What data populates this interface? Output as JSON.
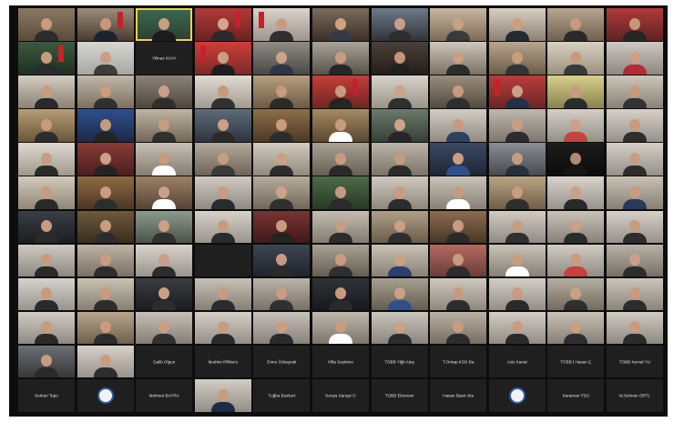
{
  "window": {
    "title": ""
  },
  "participants": [
    {
      "type": "cam",
      "a": "#8a7a63",
      "b": "#5b4a3a",
      "skin": "#c99b7b",
      "shirt": "#2c2c2c",
      "flag": false
    },
    {
      "type": "cam",
      "a": "#9b8d7d",
      "b": "#4a3a30",
      "skin": "#c8977a",
      "shirt": "#1e2230",
      "flag": true
    },
    {
      "type": "cam",
      "a": "#3e6a4e",
      "b": "#2c3d33",
      "skin": "#c7a084",
      "shirt": "#1c1c1c",
      "flag": false,
      "speaker": true
    },
    {
      "type": "cam",
      "a": "#b23b38",
      "b": "#6a2221",
      "skin": "#d4a58a",
      "shirt": "#2a2a2a",
      "flag": true
    },
    {
      "type": "cam",
      "a": "#d9d4cb",
      "b": "#9d948b",
      "skin": "#c69b80",
      "shirt": "#303030",
      "flag": true
    },
    {
      "type": "cam",
      "a": "#7b6b5b",
      "b": "#3b3028",
      "skin": "#cfa286",
      "shirt": "#323a48",
      "flag": false
    },
    {
      "type": "cam",
      "a": "#6d7b89",
      "b": "#30343a",
      "skin": "#c89e85",
      "shirt": "#2e2e2e",
      "flag": false
    },
    {
      "type": "cam",
      "a": "#c8b79f",
      "b": "#7c6a55",
      "skin": "#caa084",
      "shirt": "#3a3a3a",
      "flag": false
    },
    {
      "type": "cam",
      "a": "#d8cfc2",
      "b": "#8c8174",
      "skin": "#cc9f80",
      "shirt": "#242933",
      "flag": false
    },
    {
      "type": "cam",
      "a": "#b8a58f",
      "b": "#6f604f",
      "skin": "#c9997c",
      "shirt": "#2a2a2a",
      "flag": false
    },
    {
      "type": "cam",
      "a": "#b23a3a",
      "b": "#5e2222",
      "skin": "#c5987c",
      "shirt": "#262626",
      "flag": false
    },
    {
      "type": "cam",
      "a": "#3c5a3f",
      "b": "#1f2e21",
      "skin": "#c89b7e",
      "shirt": "#2b2b2b",
      "flag": true
    },
    {
      "type": "cam",
      "a": "#d7d7d2",
      "b": "#a7a7a1",
      "skin": "#c99f85",
      "shirt": "#3d3d3d",
      "flag": false
    },
    {
      "type": "name",
      "label": "Yilmaz KAYA"
    },
    {
      "type": "cam",
      "a": "#cf3e3a",
      "b": "#7b2a28",
      "skin": "#caa084",
      "shirt": "#1f1f1f",
      "flag": true
    },
    {
      "type": "cam",
      "a": "#8f8c86",
      "b": "#4a4844",
      "skin": "#cda387",
      "shirt": "#2f3644",
      "flag": false
    },
    {
      "type": "cam",
      "a": "#a9a398",
      "b": "#5a5249",
      "skin": "#c89c80",
      "shirt": "#272727",
      "flag": false
    },
    {
      "type": "cam",
      "a": "#4b4039",
      "b": "#241d19",
      "skin": "#c5967a",
      "shirt": "#202020",
      "flag": false
    },
    {
      "type": "cam",
      "a": "#cfc7bb",
      "b": "#7a7064",
      "skin": "#cc9f82",
      "shirt": "#2c2c2c",
      "flag": false
    },
    {
      "type": "cam",
      "a": "#b9a58e",
      "b": "#6b5b48",
      "skin": "#c99c7e",
      "shirt": "#343434",
      "flag": false
    },
    {
      "type": "cam",
      "a": "#d8d1c2",
      "b": "#9b9180",
      "skin": "#c89a7c",
      "shirt": "#3a3a3a",
      "flag": false
    },
    {
      "type": "cam",
      "a": "#cfc9c3",
      "b": "#8e8780",
      "skin": "#cc9f86",
      "shirt": "#b22d35",
      "flag": false
    },
    {
      "type": "cam",
      "a": "#d4cdc2",
      "b": "#8b8175",
      "skin": "#c79c80",
      "shirt": "#2a2a2a",
      "flag": false
    },
    {
      "type": "cam",
      "a": "#c1b8a9",
      "b": "#7b7060",
      "skin": "#c99b7f",
      "shirt": "#303030",
      "flag": false
    },
    {
      "type": "cam",
      "a": "#8c8377",
      "b": "#4e463d",
      "skin": "#cba186",
      "shirt": "#2d2d2d",
      "flag": false
    },
    {
      "type": "cam",
      "a": "#e1dcd3",
      "b": "#a19a8e",
      "skin": "#c8997b",
      "shirt": "#313131",
      "flag": false
    },
    {
      "type": "cam",
      "a": "#b79f7f",
      "b": "#6c5a45",
      "skin": "#c89a7d",
      "shirt": "#2b2b2b",
      "flag": false
    },
    {
      "type": "cam",
      "a": "#c53e3a",
      "b": "#6f2522",
      "skin": "#c69a7e",
      "shirt": "#252525",
      "flag": true
    },
    {
      "type": "cam",
      "a": "#d8d3ca",
      "b": "#9a9388",
      "skin": "#cda286",
      "shirt": "#2f2f2f",
      "flag": false
    },
    {
      "type": "cam",
      "a": "#9a8d7f",
      "b": "#524a40",
      "skin": "#c89b7e",
      "shirt": "#2e2e2e",
      "flag": false
    },
    {
      "type": "cam",
      "a": "#b93e3c",
      "b": "#6a2624",
      "skin": "#caa085",
      "shirt": "#223049",
      "flag": true
    },
    {
      "type": "cam",
      "a": "#d8cf8a",
      "b": "#8a8250",
      "skin": "#c99b80",
      "shirt": "#2c2c2c",
      "flag": false
    },
    {
      "type": "cam",
      "a": "#cbc5bb",
      "b": "#8a8276",
      "skin": "#c79a7d",
      "shirt": "#333333",
      "flag": false
    },
    {
      "type": "cam",
      "a": "#b69d76",
      "b": "#6a5638",
      "skin": "#c89b7f",
      "shirt": "#2d2d2d",
      "flag": false
    },
    {
      "type": "cam",
      "a": "#2f4f8a",
      "b": "#1a2a4a",
      "skin": "#c69a7d",
      "shirt": "#242424",
      "flag": false
    },
    {
      "type": "cam",
      "a": "#bfb4a5",
      "b": "#736857",
      "skin": "#c89c81",
      "shirt": "#303030",
      "flag": false
    },
    {
      "type": "cam",
      "a": "#5b6c7b",
      "b": "#2d353e",
      "skin": "#cba085",
      "shirt": "#2a2a2a",
      "flag": false
    },
    {
      "type": "cam",
      "a": "#8e6f49",
      "b": "#4a3925",
      "skin": "#c99b7f",
      "shirt": "#2d2d2d",
      "flag": false
    },
    {
      "type": "cam",
      "a": "#a58a63",
      "b": "#5a4830",
      "skin": "#c89a7e",
      "shirt": "#ffffff",
      "flag": false
    },
    {
      "type": "cam",
      "a": "#6b7a6a",
      "b": "#354035",
      "skin": "#cda387",
      "shirt": "#262626",
      "flag": false
    },
    {
      "type": "cam",
      "a": "#d2cdc5",
      "b": "#928a80",
      "skin": "#c89b7e",
      "shirt": "#304060",
      "flag": false
    },
    {
      "type": "cam",
      "a": "#bfb8ae",
      "b": "#7e766c",
      "skin": "#c99d82",
      "shirt": "#2c2c2c",
      "flag": false
    },
    {
      "type": "cam",
      "a": "#d4cfc6",
      "b": "#949087",
      "skin": "#cba085",
      "shirt": "#c8413c",
      "flag": false
    },
    {
      "type": "cam",
      "a": "#d6d1c9",
      "b": "#96918a",
      "skin": "#c89b7f",
      "shirt": "#2e2e2e",
      "flag": false
    },
    {
      "type": "cam",
      "a": "#ded9d0",
      "b": "#9f988d",
      "skin": "#c89c80",
      "shirt": "#2b2b2b",
      "flag": false
    },
    {
      "type": "cam",
      "a": "#8a3a36",
      "b": "#4a1f1d",
      "skin": "#caa086",
      "shirt": "#232323",
      "flag": false
    },
    {
      "type": "cam",
      "a": "#c7c0b4",
      "b": "#857d71",
      "skin": "#c89a7e",
      "shirt": "#ffffff",
      "flag": false
    },
    {
      "type": "cam",
      "a": "#b5ab9c",
      "b": "#6d6457",
      "skin": "#c99c80",
      "shirt": "#3a3a3a",
      "flag": false
    },
    {
      "type": "cam",
      "a": "#d2ccc0",
      "b": "#908a7e",
      "skin": "#cba186",
      "shirt": "#2d2d2d",
      "flag": false
    },
    {
      "type": "cam",
      "a": "#a8a194",
      "b": "#666055",
      "skin": "#c89b7f",
      "shirt": "#2a2a2a",
      "flag": false
    },
    {
      "type": "cam",
      "a": "#bcb5a9",
      "b": "#7a7367",
      "skin": "#c69a7e",
      "shirt": "#2c2c2c",
      "flag": false
    },
    {
      "type": "cam",
      "a": "#3c4a64",
      "b": "#1e2534",
      "skin": "#c99d82",
      "shirt": "#2f4f8a",
      "flag": false
    },
    {
      "type": "cam",
      "a": "#8a8e94",
      "b": "#474a4e",
      "skin": "#c89b80",
      "shirt": "#263040",
      "flag": false
    },
    {
      "type": "cam",
      "a": "#1c1c1c",
      "b": "#0c0c0c",
      "skin": "#b08a70",
      "shirt": "#151515",
      "flag": false
    },
    {
      "type": "cam",
      "a": "#d4cfc7",
      "b": "#959089",
      "skin": "#c99c80",
      "shirt": "#2d2d2d",
      "flag": false
    },
    {
      "type": "cam",
      "a": "#d2c9bb",
      "b": "#908778",
      "skin": "#c89b7f",
      "shirt": "#2a2a2a",
      "flag": false
    },
    {
      "type": "cam",
      "a": "#8f6a45",
      "b": "#4b3722",
      "skin": "#c99c80",
      "shirt": "#2d2d2d",
      "flag": false
    },
    {
      "type": "cam",
      "a": "#9b8166",
      "b": "#554433",
      "skin": "#caa085",
      "shirt": "#ffffff",
      "flag": false
    },
    {
      "type": "cam",
      "a": "#d0cbc2",
      "b": "#8f8a81",
      "skin": "#c89b7f",
      "shirt": "#2c2c2c",
      "flag": false
    },
    {
      "type": "cam",
      "a": "#b7ad9e",
      "b": "#716757",
      "skin": "#cda387",
      "shirt": "#303030",
      "flag": false
    },
    {
      "type": "cam",
      "a": "#4e6b4a",
      "b": "#283826",
      "skin": "#c89a7e",
      "shirt": "#2b2b2b",
      "flag": false
    },
    {
      "type": "cam",
      "a": "#cfc9bf",
      "b": "#8d877c",
      "skin": "#c99c80",
      "shirt": "#2d2d2d",
      "flag": false
    },
    {
      "type": "cam",
      "a": "#c9c3b8",
      "b": "#878075",
      "skin": "#c89b80",
      "shirt": "#ffffff",
      "flag": false
    },
    {
      "type": "cam",
      "a": "#b9a486",
      "b": "#6f5e45",
      "skin": "#c99d82",
      "shirt": "#2e2e2e",
      "flag": false
    },
    {
      "type": "cam",
      "a": "#d7d2ca",
      "b": "#98938b",
      "skin": "#cba085",
      "shirt": "#2a2a2a",
      "flag": false
    },
    {
      "type": "cam",
      "a": "#c8c1b5",
      "b": "#877f72",
      "skin": "#c89b7f",
      "shirt": "#283a5a",
      "flag": false
    },
    {
      "type": "cam",
      "a": "#3a3f44",
      "b": "#1b1d20",
      "skin": "#c89b7f",
      "shirt": "#2a2a2a",
      "flag": false
    },
    {
      "type": "cam",
      "a": "#6e5a3d",
      "b": "#3a2e1e",
      "skin": "#c99c80",
      "shirt": "#2d2d2d",
      "flag": false
    },
    {
      "type": "cam",
      "a": "#8c9a8a",
      "b": "#4a544a",
      "skin": "#cba186",
      "shirt": "#303030",
      "flag": false
    },
    {
      "type": "cam",
      "a": "#d7d2ca",
      "b": "#98938b",
      "skin": "#c89b7f",
      "shirt": "#2b2b2b",
      "flag": false
    },
    {
      "type": "cam",
      "a": "#7c3232",
      "b": "#3f1a1a",
      "skin": "#c89a7e",
      "shirt": "#232323",
      "flag": false
    },
    {
      "type": "cam",
      "a": "#c4bdb1",
      "b": "#837b6f",
      "skin": "#c99c80",
      "shirt": "#2c2c2c",
      "flag": false
    },
    {
      "type": "cam",
      "a": "#b0a08a",
      "b": "#6a5c48",
      "skin": "#caa085",
      "shirt": "#2e2e2e",
      "flag": false
    },
    {
      "type": "cam",
      "a": "#8a6d4e",
      "b": "#473726",
      "skin": "#c89b80",
      "shirt": "#2a2a2a",
      "flag": false
    },
    {
      "type": "cam",
      "a": "#d1ccc3",
      "b": "#908b82",
      "skin": "#c99d82",
      "shirt": "#303030",
      "flag": false
    },
    {
      "type": "cam",
      "a": "#c8c2b8",
      "b": "#878177",
      "skin": "#cba086",
      "shirt": "#2b2b2b",
      "flag": false
    },
    {
      "type": "cam",
      "a": "#d5d0c8",
      "b": "#96918a",
      "skin": "#c89b7f",
      "shirt": "#2d2d2d",
      "flag": false
    },
    {
      "type": "cam",
      "a": "#cfcac1",
      "b": "#8e8980",
      "skin": "#c89b7f",
      "shirt": "#2a2a2a",
      "flag": false
    },
    {
      "type": "cam",
      "a": "#bdb4a6",
      "b": "#7a7163",
      "skin": "#c99c80",
      "shirt": "#2d2d2d",
      "flag": false
    },
    {
      "type": "cam",
      "a": "#d8d3cb",
      "b": "#99948c",
      "skin": "#caa085",
      "shirt": "#2c2c2c",
      "flag": false
    },
    {
      "type": "name",
      "label": ""
    },
    {
      "type": "cam",
      "a": "#3c4653",
      "b": "#1f242b",
      "skin": "#c89b7f",
      "shirt": "#2a2a2a",
      "flag": false
    },
    {
      "type": "cam",
      "a": "#a9a193",
      "b": "#655e52",
      "skin": "#c99c80",
      "shirt": "#2e2e2e",
      "flag": false
    },
    {
      "type": "cam",
      "a": "#c9c2b6",
      "b": "#888074",
      "skin": "#cba186",
      "shirt": "#2b3f6a",
      "flag": false
    },
    {
      "type": "cam",
      "a": "#b36a62",
      "b": "#6a3d38",
      "skin": "#c89b80",
      "shirt": "#2d2d2d",
      "flag": false
    },
    {
      "type": "cam",
      "a": "#c8c2b7",
      "b": "#868076",
      "skin": "#c99d82",
      "shirt": "#ffffff",
      "flag": false
    },
    {
      "type": "cam",
      "a": "#d2cdc4",
      "b": "#918c83",
      "skin": "#c89b7f",
      "shirt": "#c8413c",
      "flag": false
    },
    {
      "type": "cam",
      "a": "#b8b1a5",
      "b": "#757065",
      "skin": "#cba086",
      "shirt": "#2d2d2d",
      "flag": false
    },
    {
      "type": "cam",
      "a": "#d6d3cc",
      "b": "#97948d",
      "skin": "#c89b7f",
      "shirt": "#2a2a2a",
      "flag": false
    },
    {
      "type": "cam",
      "a": "#c9c1b2",
      "b": "#878072",
      "skin": "#c99c80",
      "shirt": "#2d2d2d",
      "flag": false
    },
    {
      "type": "cam",
      "a": "#3a3c40",
      "b": "#1c1d1f",
      "skin": "#caa085",
      "shirt": "#2c2c2c",
      "flag": false
    },
    {
      "type": "cam",
      "a": "#c7c1b6",
      "b": "#857f75",
      "skin": "#c89b80",
      "shirt": "#2b2b2b",
      "flag": false
    },
    {
      "type": "cam",
      "a": "#bbb4a8",
      "b": "#777166",
      "skin": "#c99d82",
      "shirt": "#303030",
      "flag": false
    },
    {
      "type": "cam",
      "a": "#2f3338",
      "b": "#17191c",
      "skin": "#c89b7f",
      "shirt": "#2a2a2a",
      "flag": false
    },
    {
      "type": "cam",
      "a": "#a6a08f",
      "b": "#625d50",
      "skin": "#cba186",
      "shirt": "#2f4f8a",
      "flag": false
    },
    {
      "type": "cam",
      "a": "#cfc8bc",
      "b": "#8e877b",
      "skin": "#c89b80",
      "shirt": "#2d2d2d",
      "flag": false
    },
    {
      "type": "cam",
      "a": "#d3cec6",
      "b": "#928d85",
      "skin": "#c99c80",
      "shirt": "#2a2a2a",
      "flag": false
    },
    {
      "type": "cam",
      "a": "#b6af9f",
      "b": "#726b5d",
      "skin": "#caa085",
      "shirt": "#2e2e2e",
      "flag": false
    },
    {
      "type": "cam",
      "a": "#cbc5bb",
      "b": "#8a8478",
      "skin": "#c89b7f",
      "shirt": "#2c2c2c",
      "flag": false
    },
    {
      "type": "cam",
      "a": "#d0cbc3",
      "b": "#8f8a82",
      "skin": "#c89b7f",
      "shirt": "#2a2a2a",
      "flag": false
    },
    {
      "type": "cam",
      "a": "#b7a58d",
      "b": "#6f604b",
      "skin": "#c99c80",
      "shirt": "#2d2d2d",
      "flag": false
    },
    {
      "type": "cam",
      "a": "#c5bfb5",
      "b": "#847e74",
      "skin": "#caa085",
      "shirt": "#303030",
      "flag": false
    },
    {
      "type": "cam",
      "a": "#d4cfc7",
      "b": "#948f87",
      "skin": "#c89b80",
      "shirt": "#2b2b2b",
      "flag": false
    },
    {
      "type": "cam",
      "a": "#c7c2ba",
      "b": "#86817a",
      "skin": "#c99d82",
      "shirt": "#2a2a2a",
      "flag": false
    },
    {
      "type": "cam",
      "a": "#bfb8ac",
      "b": "#7c766a",
      "skin": "#c89b7f",
      "shirt": "#ffffff",
      "flag": false
    },
    {
      "type": "cam",
      "a": "#cbc6bd",
      "b": "#8a857c",
      "skin": "#cba186",
      "shirt": "#2d2d2d",
      "flag": false
    },
    {
      "type": "cam",
      "a": "#b9b1a4",
      "b": "#766e62",
      "skin": "#c89b80",
      "shirt": "#2c2c2c",
      "flag": false
    },
    {
      "type": "cam",
      "a": "#d2cdc5",
      "b": "#918c84",
      "skin": "#c99c80",
      "shirt": "#2a2a2a",
      "flag": false
    },
    {
      "type": "cam",
      "a": "#c8c1b6",
      "b": "#877f74",
      "skin": "#caa085",
      "shirt": "#2e2e2e",
      "flag": false
    },
    {
      "type": "cam",
      "a": "#cfcac2",
      "b": "#8e8981",
      "skin": "#c89b7f",
      "shirt": "#2b2b2b",
      "flag": false
    },
    {
      "type": "cam",
      "a": "#6c6f73",
      "b": "#36383a",
      "skin": "#c89b7f",
      "shirt": "#2a2a2a",
      "flag": false
    },
    {
      "type": "cam",
      "a": "#d6d1c9",
      "b": "#97928a",
      "skin": "#c99c80",
      "shirt": "#2d2d2d",
      "flag": false
    },
    {
      "type": "name",
      "label": "Galib Olgun"
    },
    {
      "type": "name",
      "label": "İbrahim İPlikta'o"
    },
    {
      "type": "name",
      "label": "Emre Özbayrak"
    },
    {
      "type": "name",
      "label": "Hilla Seyitimo"
    },
    {
      "type": "name",
      "label": "TOBB Yiğit Ateş"
    },
    {
      "type": "name",
      "label": "T.Ortrap KSO Ba"
    },
    {
      "type": "name",
      "label": "Aziz Kanat"
    },
    {
      "type": "name",
      "label": "TOBB | Hasan Ç"
    },
    {
      "type": "name",
      "label": "TOBB Kemal YU"
    },
    {
      "type": "name",
      "label": "Serkan Topo"
    },
    {
      "type": "logo"
    },
    {
      "type": "name",
      "label": "Mehmet BAYRA"
    },
    {
      "type": "cam",
      "a": "#d2cdc5",
      "b": "#918c84",
      "skin": "#c99c80",
      "shirt": "#1f2a44",
      "flag": false
    },
    {
      "type": "name",
      "label": "Tuğba Bozkurt"
    },
    {
      "type": "name",
      "label": "Konya Sanayi O"
    },
    {
      "type": "name",
      "label": "TOBB Ekonomi"
    },
    {
      "type": "name",
      "label": "Hasan Basri Aks"
    },
    {
      "type": "logo"
    },
    {
      "type": "name",
      "label": "Karaman TSO"
    },
    {
      "type": "name",
      "label": "M.Selman ORTL"
    }
  ],
  "side_note": ""
}
